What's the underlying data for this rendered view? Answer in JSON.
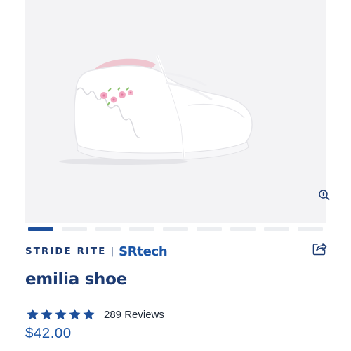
{
  "product": {
    "brand": {
      "name": "STRIDE RITE",
      "separator": "|",
      "tech_logo": "SRtech"
    },
    "title": "emilia shoe",
    "rating": {
      "stars": 5,
      "max_stars": 5,
      "reviews_label": "289 Reviews"
    },
    "price": "$42.00"
  },
  "gallery": {
    "slide_count": 9,
    "active_slide": 1,
    "zoom_icon": "zoom-in-icon"
  },
  "actions": {
    "share_icon": "share-icon"
  },
  "colors": {
    "brand_navy": "#1d3b72",
    "accent_blue": "#1a55a6",
    "active_dot": "#1d4f9b",
    "inactive_dot": "#eceef1",
    "star": "#1d4f9b",
    "image_bg": "#f3f3f5"
  }
}
